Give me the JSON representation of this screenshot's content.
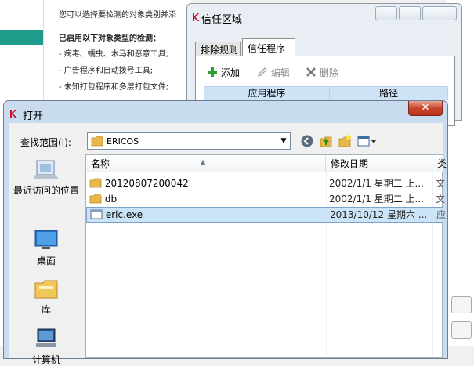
{
  "background_panel": {
    "lines": [
      "您可以选择要检测的对象类别并添",
      "已启用以下对象类型的检测：",
      "- 病毒、蠕虫、木马和恶意工具;",
      "- 广告程序和自动拨号工具;",
      "- 未知打包程序和多层打包文件;"
    ]
  },
  "trust_window": {
    "title": "信任区域",
    "tabs": [
      "排除规则",
      "信任程序"
    ],
    "toolbar": {
      "add": "添加",
      "edit": "编辑",
      "delete": "删除"
    },
    "columns": [
      "应用程序",
      "路径"
    ]
  },
  "open_dialog": {
    "title": "打开",
    "close_glyph": "✕",
    "look_in_label": "查找范围(I):",
    "look_in_value": "ERICOS",
    "places": [
      "最近访问的位置",
      "桌面",
      "库",
      "计算机"
    ],
    "columns": {
      "name": "名称",
      "date": "修改日期",
      "more": "类"
    },
    "files": [
      {
        "name": "20120807200042",
        "date": "2002/1/1 星期二 上...",
        "more": "文",
        "type": "folder"
      },
      {
        "name": "db",
        "date": "2002/1/1 星期二 上...",
        "more": "文",
        "type": "folder"
      },
      {
        "name": "eric.exe",
        "date": "2013/10/12 星期六 ...",
        "more": "应",
        "type": "exe",
        "selected": true
      }
    ]
  },
  "colors": {
    "accent_teal": "#1e9b8a",
    "selection": "#cce4f7",
    "frame": "#c9dcef"
  }
}
